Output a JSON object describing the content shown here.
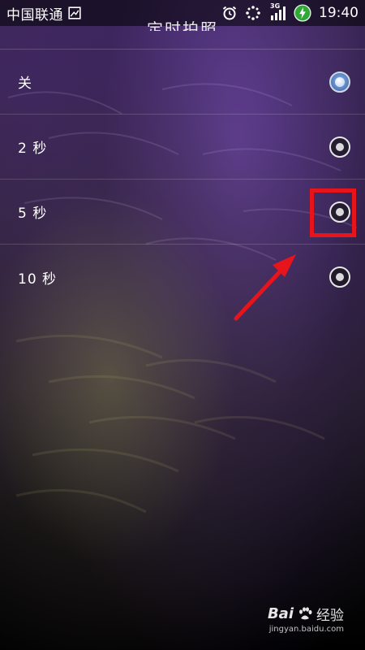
{
  "status_bar": {
    "carrier": "中国联通",
    "network_label": "3G",
    "time": "19:40",
    "icons": [
      "image-icon",
      "alarm-icon",
      "sync-icon",
      "signal-icon",
      "battery-icon"
    ]
  },
  "dialog": {
    "title": "定时拍照"
  },
  "options": [
    {
      "label": "关",
      "selected": true
    },
    {
      "label": "2 秒",
      "selected": false
    },
    {
      "label": "5 秒",
      "selected": false
    },
    {
      "label": "10 秒",
      "selected": false
    }
  ],
  "annotation": {
    "highlight_color": "#e8141b"
  },
  "watermark": {
    "brand": "Bai",
    "brand_suffix": "经验",
    "url": "jingyan.baidu.com"
  }
}
